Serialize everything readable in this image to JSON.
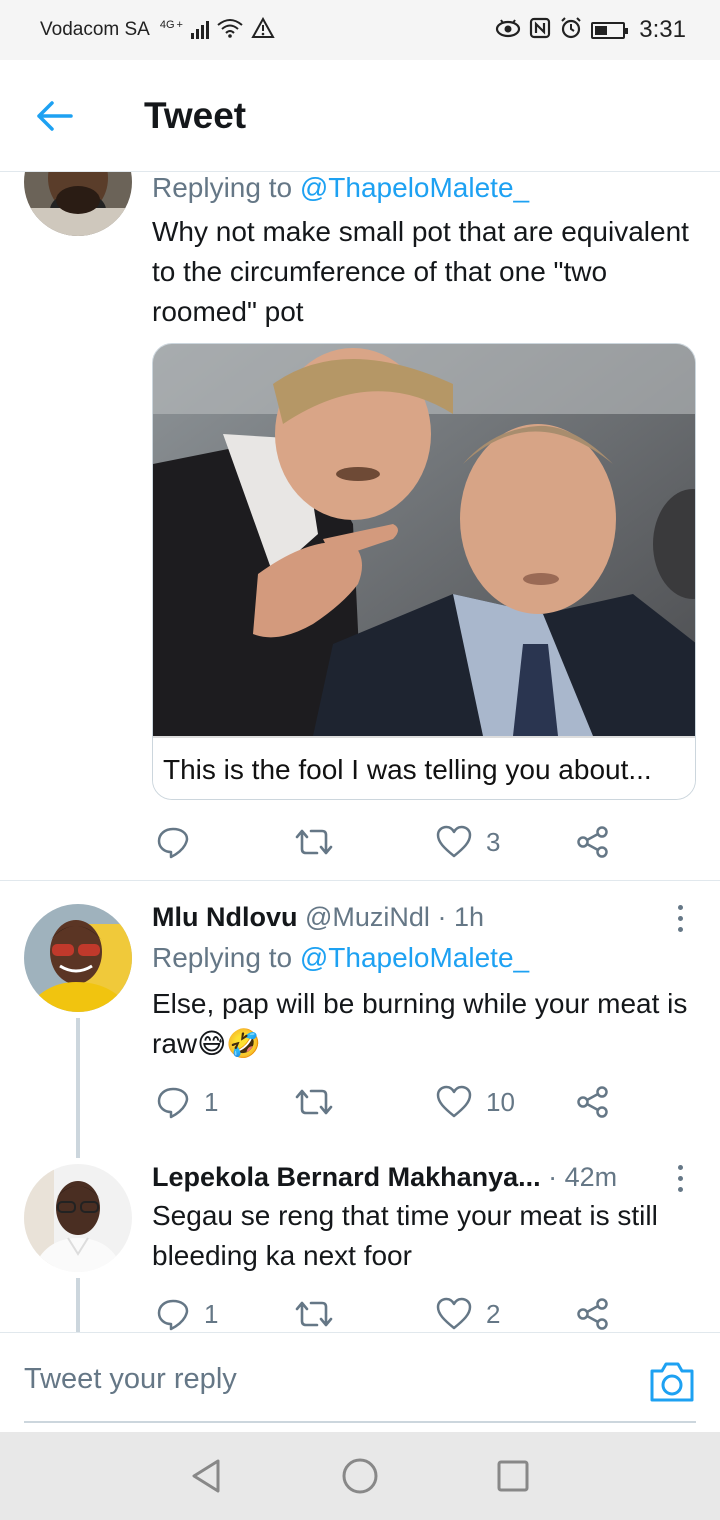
{
  "status_bar": {
    "carrier": "Vodacom SA",
    "network": "4G",
    "network_plus": "+",
    "time": "3:31"
  },
  "header": {
    "title": "Tweet",
    "back_icon": "arrow-left-icon"
  },
  "tweets": [
    {
      "replying_prefix": "Replying to ",
      "replying_handle": "@ThapeloMalete_",
      "text": "Why not make small pot that are equivalent to the circumference of that one \"two roomed\" pot",
      "media_caption": "This is the fool I was telling you about...",
      "reply_count": "",
      "retweet_count": "",
      "like_count": "3"
    },
    {
      "name": "Mlu Ndlovu",
      "handle": "@MuziNdl",
      "time": "· 1h",
      "replying_prefix": "Replying to ",
      "replying_handle": "@ThapeloMalete_",
      "text": "Else, pap will be burning while your meat is raw😅🤣",
      "reply_count": "1",
      "retweet_count": "",
      "like_count": "10"
    },
    {
      "name": "Lepekola Bernard Makhanya...",
      "time": "· 42m",
      "text": "Segau se reng that time your meat is still bleeding ka next foor",
      "reply_count": "1",
      "retweet_count": "",
      "like_count": "2"
    }
  ],
  "composer": {
    "placeholder": "Tweet your reply"
  },
  "colors": {
    "accent": "#1da1f2",
    "secondary_text": "#657786",
    "primary_text": "#14171a",
    "divider": "#e1e8ed"
  }
}
